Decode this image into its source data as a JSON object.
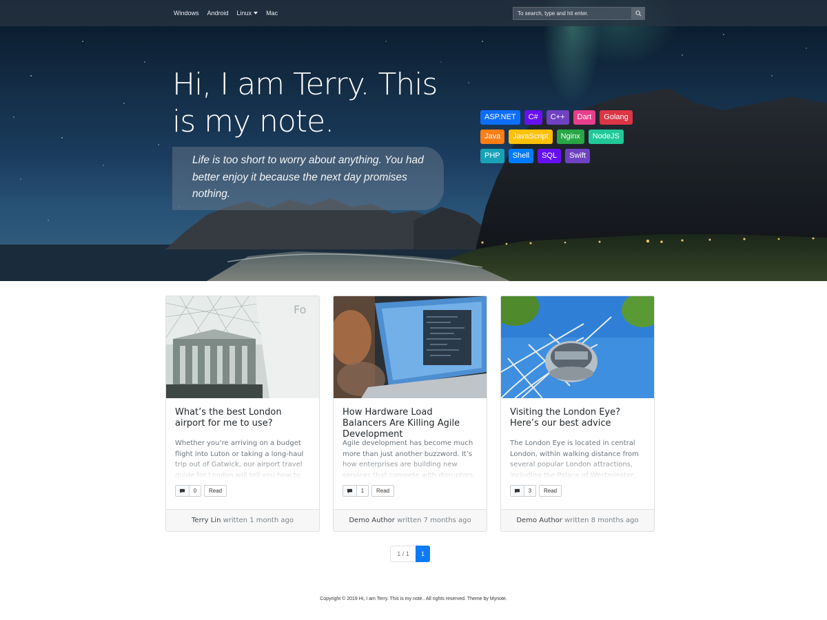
{
  "nav": {
    "items": [
      "Windows",
      "Android",
      "Linux",
      "Mac"
    ],
    "search_placeholder": "To search, type and hit enter."
  },
  "hero": {
    "title": "Hi, I am Terry. This is my note.",
    "quote": "Life is too short to worry about anything. You had better enjoy it because the next day promises nothing."
  },
  "tags": [
    {
      "label": "ASP.NET",
      "color": "#0d6efd"
    },
    {
      "label": "C#",
      "color": "#6610f2"
    },
    {
      "label": "C++",
      "color": "#6f42c1"
    },
    {
      "label": "Dart",
      "color": "#e83e8c"
    },
    {
      "label": "Golang",
      "color": "#dc3545"
    },
    {
      "label": "Java",
      "color": "#fd7e14"
    },
    {
      "label": "JavaScript",
      "color": "#ffc107"
    },
    {
      "label": "Nginx",
      "color": "#28a745"
    },
    {
      "label": "NodeJS",
      "color": "#20c997"
    },
    {
      "label": "PHP",
      "color": "#17a2b8"
    },
    {
      "label": "Shell",
      "color": "#007bff"
    },
    {
      "label": "SQL",
      "color": "#6610f2"
    },
    {
      "label": "Swift",
      "color": "#6f42c1"
    }
  ],
  "posts": [
    {
      "title": "What’s the best London airport for me to use?",
      "excerpt": "Whether you’re arriving on a budget flight into Luton or taking a long-haul trip out of Gatwick, our airport travel guide for London will tell you how to get in and out of each London airport with ease...",
      "comments": "0",
      "read_label": "Read",
      "author": "Terry Lin",
      "meta": "written 1 month ago"
    },
    {
      "title": "How Hardware Load Balancers Are Killing Agile Development",
      "excerpt": "Agile development has become much more than just another buzzword. It’s how enterprises are building new services that compete with disruptors who are delivering new capabilities at a rapid pace...",
      "comments": "1",
      "read_label": "Read",
      "author": "Demo Author",
      "meta": "written 7 months ago"
    },
    {
      "title": "Visiting the London Eye? Here’s our best advice",
      "excerpt": "The London Eye is located in central London, within walking distance from several popular London attractions, including the Palace of Westminster, Big Ben and the London Aquarium...",
      "comments": "3",
      "read_label": "Read",
      "author": "Demo Author",
      "meta": "written 8 months ago"
    }
  ],
  "pagination": {
    "info": "1 / 1",
    "current": "1"
  },
  "footer": {
    "text": "Copyright © 2019 Hi, I am Terry. This is my note.. All rights reserved. Theme by Mynote."
  }
}
